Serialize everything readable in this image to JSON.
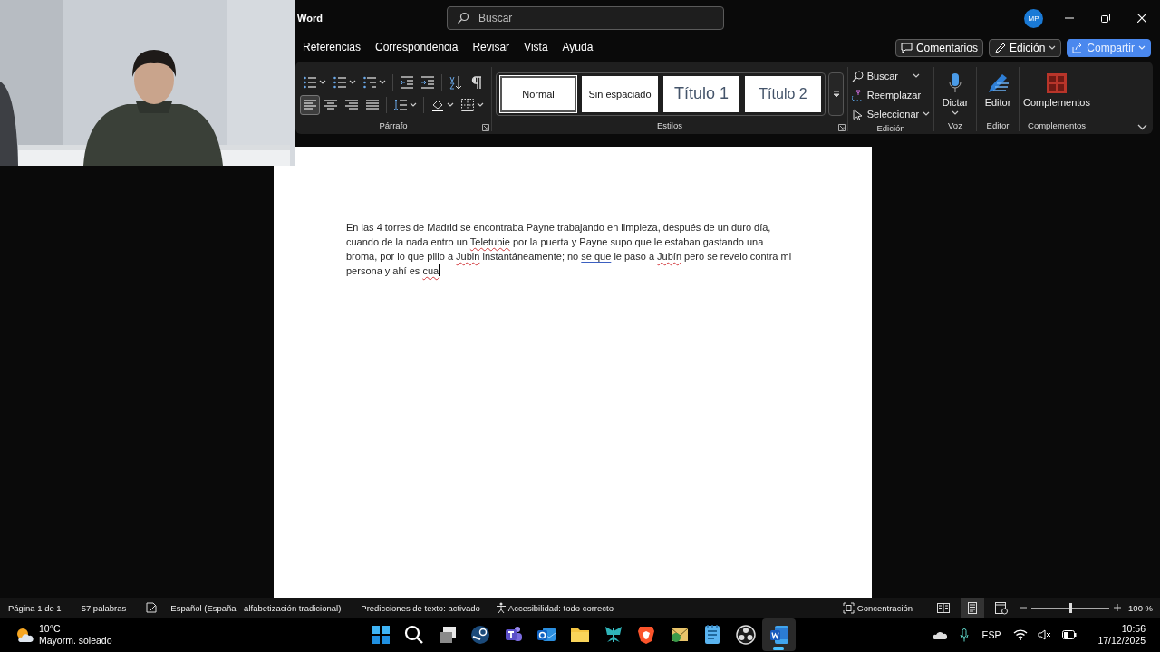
{
  "window": {
    "app": "Word",
    "search_placeholder": "Buscar",
    "account_initials": "MP"
  },
  "tabs": [
    {
      "label": "Referencias",
      "selected": false
    },
    {
      "label": "Correspondencia",
      "selected": false
    },
    {
      "label": "Revisar",
      "selected": false
    },
    {
      "label": "Vista",
      "selected": false
    },
    {
      "label": "Ayuda",
      "selected": false
    }
  ],
  "header_buttons": [
    {
      "kind": "comments",
      "label": "Comentarios"
    },
    {
      "kind": "mode",
      "label": "Edición"
    },
    {
      "kind": "share",
      "label": "Compartir"
    }
  ],
  "ribbon": {
    "groups": [
      {
        "kind": "paragraph",
        "title": "Párrafo",
        "align_buttons": [
          {
            "kind": "left",
            "selected": true
          },
          {
            "kind": "center",
            "selected": false
          },
          {
            "kind": "right",
            "selected": false
          },
          {
            "kind": "justify",
            "selected": false
          }
        ]
      },
      {
        "kind": "styles",
        "title": "Estilos",
        "styles": [
          {
            "label": "Normal",
            "selected": true
          },
          {
            "label": "Sin espaciado",
            "selected": false
          },
          {
            "label": "Título 1",
            "selected": false
          },
          {
            "label": "Título 2",
            "selected": false
          }
        ]
      },
      {
        "kind": "editing",
        "title": "Edición",
        "items": [
          "Buscar",
          "Reemplazar",
          "Seleccionar"
        ]
      },
      {
        "kind": "voice",
        "title": "Voz",
        "button": "Dictar"
      },
      {
        "kind": "editor",
        "title": "Editor",
        "button": "Editor"
      },
      {
        "kind": "addins",
        "title": "Complementos",
        "button": "Complementos"
      }
    ]
  },
  "document": {
    "cursor_at_end": true,
    "segments": [
      {
        "kind": "plain",
        "text": "En las 4 torres de Madrid se encontraba Payne trabajando en limpieza, después de un duro día, cuando de la nada entro un "
      },
      {
        "kind": "spelling",
        "text": "Teletubie"
      },
      {
        "kind": "plain",
        "text": " por la puerta y Payne supo que le estaban gastando una broma, por lo que pillo a "
      },
      {
        "kind": "spelling",
        "text": "Jubin"
      },
      {
        "kind": "plain",
        "text": " instantáneamente; no "
      },
      {
        "kind": "grammar",
        "text": "se que"
      },
      {
        "kind": "plain",
        "text": " le paso a "
      },
      {
        "kind": "spelling",
        "text": "Jubín"
      },
      {
        "kind": "plain",
        "text": " pero se revelo contra mi persona y ahí es "
      },
      {
        "kind": "spelling",
        "text": "cua"
      }
    ]
  },
  "status_bar": {
    "page": "Página 1 de 1",
    "words": "57 palabras",
    "language": "Español (España - alfabetización tradicional)",
    "predictions": "Predicciones de texto: activado",
    "accessibility": "Accesibilidad: todo correcto",
    "focus": "Concentración",
    "views": [
      {
        "kind": "read",
        "selected": false
      },
      {
        "kind": "print",
        "selected": true
      },
      {
        "kind": "web",
        "selected": false
      }
    ],
    "zoom": {
      "level": 0.5,
      "reading": "100 %"
    }
  },
  "taskbar": {
    "weather": {
      "temperature": "10°C",
      "condition": "Mayorm. soleado"
    },
    "apps": [
      {
        "kind": "start",
        "active": false
      },
      {
        "kind": "search",
        "active": false
      },
      {
        "kind": "taskview",
        "active": false
      },
      {
        "kind": "steam",
        "active": false
      },
      {
        "kind": "teams",
        "active": false
      },
      {
        "kind": "outlook",
        "active": false
      },
      {
        "kind": "explorer",
        "active": false
      },
      {
        "kind": "bug",
        "active": false
      },
      {
        "kind": "brave",
        "active": false
      },
      {
        "kind": "mail",
        "active": false
      },
      {
        "kind": "notepad",
        "active": false
      },
      {
        "kind": "obs",
        "active": false
      },
      {
        "kind": "word",
        "active": true
      }
    ],
    "language": "ESP",
    "time": "10:56",
    "date": "17/12/2025"
  }
}
